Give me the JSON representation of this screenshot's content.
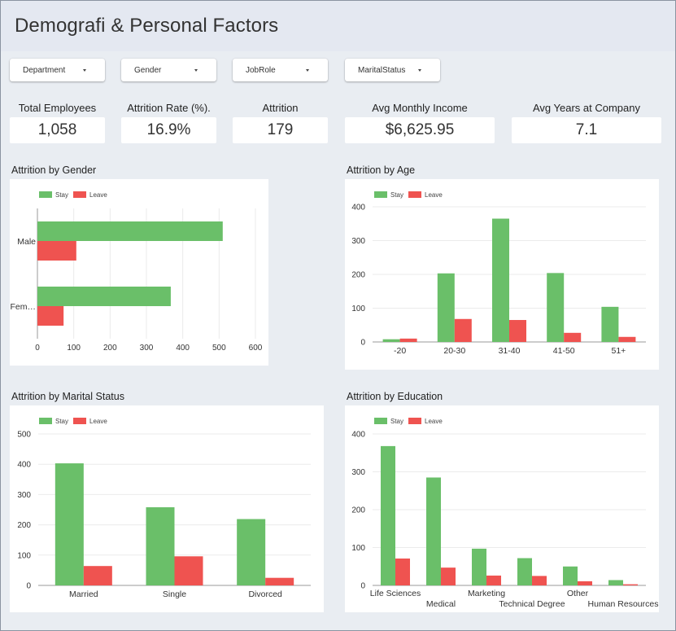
{
  "page": {
    "title": "Demografi & Personal Factors"
  },
  "filters": [
    {
      "label": "Department"
    },
    {
      "label": "Gender"
    },
    {
      "label": "JobRole"
    },
    {
      "label": "MaritalStatus"
    }
  ],
  "kpis": [
    {
      "label": "Total Employees",
      "value": "1,058"
    },
    {
      "label": "Attrition Rate (%).",
      "value": "16.9%"
    },
    {
      "label": "Attrition",
      "value": "179"
    },
    {
      "label": "Avg Monthly Income",
      "value": "$6,625.95"
    },
    {
      "label": "Avg Years at Company",
      "value": "7.1"
    }
  ],
  "colors": {
    "stay": "#6abf69",
    "leave": "#ef5350",
    "grid": "#ebebeb"
  },
  "chart_data": [
    {
      "type": "bar",
      "orientation": "horizontal",
      "title": "Attrition by Gender",
      "categories": [
        "Male",
        "Fem…"
      ],
      "series": [
        {
          "name": "Stay",
          "values": [
            510,
            367
          ]
        },
        {
          "name": "Leave",
          "values": [
            107,
            72
          ]
        }
      ],
      "xlim": [
        0,
        600
      ],
      "ticks": [
        0,
        100,
        200,
        300,
        400,
        500,
        600
      ],
      "legend": "top-left",
      "grid": true
    },
    {
      "type": "bar",
      "title": "Attrition by Age",
      "categories": [
        "-20",
        "20-30",
        "31-40",
        "41-50",
        "51+"
      ],
      "series": [
        {
          "name": "Stay",
          "values": [
            8,
            203,
            365,
            204,
            104
          ]
        },
        {
          "name": "Leave",
          "values": [
            10,
            68,
            65,
            27,
            15
          ]
        }
      ],
      "ylim": [
        0,
        400
      ],
      "ticks": [
        0,
        100,
        200,
        300,
        400
      ],
      "legend": "top-left",
      "grid": true
    },
    {
      "type": "bar",
      "title": "Attrition by Marital Status",
      "categories": [
        "Married",
        "Single",
        "Divorced"
      ],
      "series": [
        {
          "name": "Stay",
          "values": [
            403,
            258,
            219
          ]
        },
        {
          "name": "Leave",
          "values": [
            64,
            96,
            25
          ]
        }
      ],
      "ylim": [
        0,
        500
      ],
      "ticks": [
        0,
        100,
        200,
        300,
        400,
        500
      ],
      "legend": "top-left",
      "grid": true
    },
    {
      "type": "bar",
      "title": "Attrition by Education",
      "categories": [
        "Life Sciences",
        "Medical",
        "Marketing",
        "Technical Degree",
        "Other",
        "Human Resources"
      ],
      "series": [
        {
          "name": "Stay",
          "values": [
            368,
            285,
            97,
            72,
            50,
            14
          ]
        },
        {
          "name": "Leave",
          "values": [
            71,
            47,
            26,
            25,
            11,
            3
          ]
        }
      ],
      "ylim": [
        0,
        400
      ],
      "ticks": [
        0,
        100,
        200,
        300,
        400
      ],
      "legend": "top-left",
      "grid": true
    }
  ]
}
